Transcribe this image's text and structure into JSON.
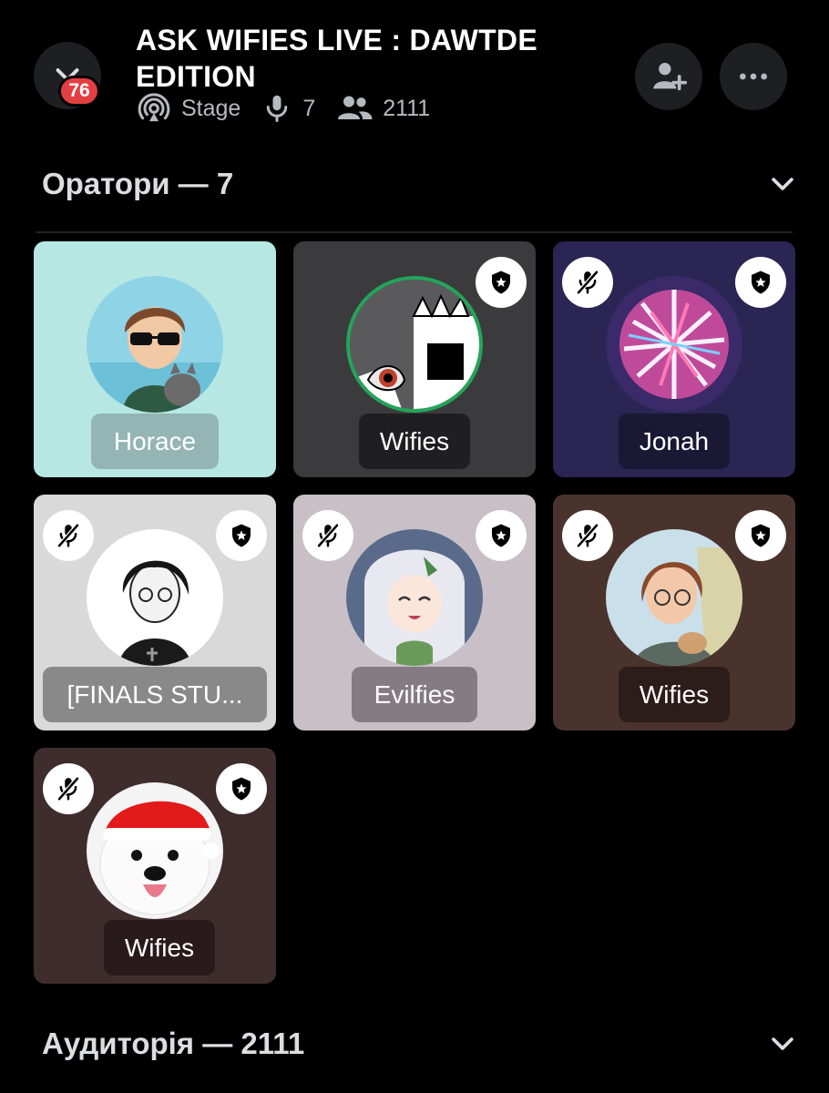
{
  "header": {
    "title": "ASK WIFIES LIVE : DAWTDE EDITION",
    "notification_count": "76",
    "channel_type": "Stage",
    "speaker_count": "7",
    "listener_count": "2111"
  },
  "speakers_section": {
    "title": "Оратори — 7"
  },
  "audience_section": {
    "title": "Аудиторія — 2111"
  },
  "speakers": [
    {
      "name": "Horace",
      "muted": false,
      "moderator": false,
      "bg": "#b6e7e3",
      "pill": "rgba(120,140,140,0.55)"
    },
    {
      "name": "Wifies",
      "muted": false,
      "moderator": true,
      "bg": "#3b3b3d",
      "pill": "rgba(20,20,22,0.7)"
    },
    {
      "name": "Jonah",
      "muted": true,
      "moderator": true,
      "bg": "#2a2553",
      "pill": "rgba(20,18,40,0.7)"
    },
    {
      "name": "[FINALS STU...",
      "muted": true,
      "moderator": true,
      "bg": "#d9d9d9",
      "pill": "rgba(110,110,110,0.75)"
    },
    {
      "name": "Evilfies",
      "muted": true,
      "moderator": true,
      "bg": "#c8c0c6",
      "pill": "rgba(110,100,108,0.75)"
    },
    {
      "name": "Wifies",
      "muted": true,
      "moderator": true,
      "bg": "#4a332d",
      "pill": "rgba(35,22,20,0.75)"
    },
    {
      "name": "Wifies",
      "muted": true,
      "moderator": true,
      "bg": "#3f2c2d",
      "pill": "rgba(35,22,22,0.75)"
    }
  ],
  "colors": {
    "background": "#000000",
    "badge": "#e23f42",
    "speaking_ring": "#23a55a"
  }
}
